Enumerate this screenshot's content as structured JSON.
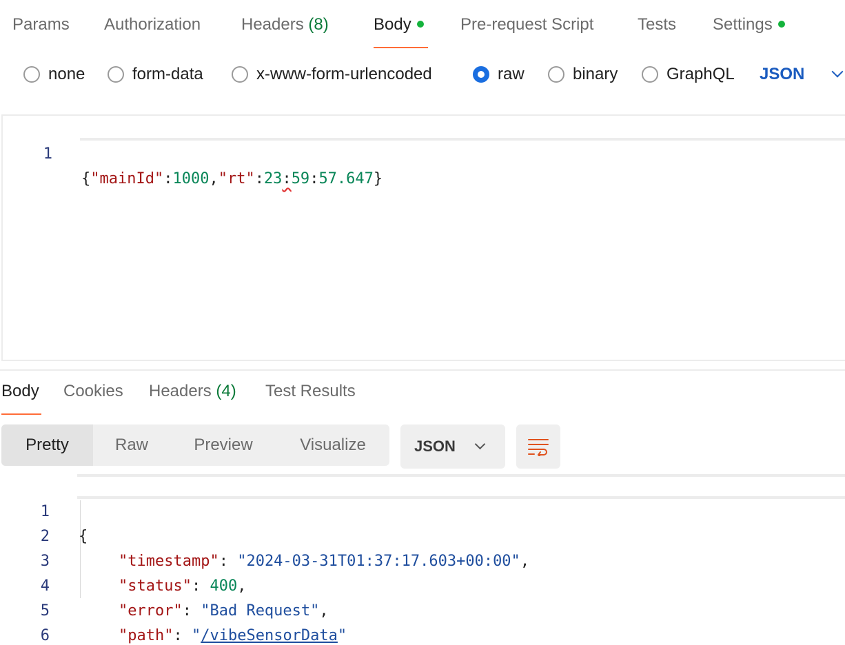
{
  "request_tabs": [
    {
      "label": "Params"
    },
    {
      "label": "Authorization"
    },
    {
      "label": "Headers",
      "count": "(8)"
    },
    {
      "label": "Body",
      "indicator": true,
      "active": true
    },
    {
      "label": "Pre-request Script"
    },
    {
      "label": "Tests"
    },
    {
      "label": "Settings",
      "indicator": true
    }
  ],
  "body_types": [
    {
      "label": "none",
      "checked": false
    },
    {
      "label": "form-data",
      "checked": false
    },
    {
      "label": "x-www-form-urlencoded",
      "checked": false
    },
    {
      "label": "raw",
      "checked": true
    },
    {
      "label": "binary",
      "checked": false
    },
    {
      "label": "GraphQL",
      "checked": false
    }
  ],
  "raw_format": "JSON",
  "request_body": {
    "line_number": "1",
    "tokens": {
      "open": "{",
      "key1": "\"mainId\"",
      "colon1": ":",
      "val1": "1000",
      "comma": ",",
      "key2": "\"rt\"",
      "colon2": ":",
      "val2a": "23",
      "colon3": ":",
      "val2b": "59",
      "colon4": ":",
      "val2c": "57.647",
      "close": "}"
    }
  },
  "response_tabs": [
    {
      "label": "Body",
      "active": true
    },
    {
      "label": "Cookies"
    },
    {
      "label": "Headers",
      "count": "(4)"
    },
    {
      "label": "Test Results"
    }
  ],
  "view_modes": [
    "Pretty",
    "Raw",
    "Preview",
    "Visualize"
  ],
  "response_format": "JSON",
  "response_body": {
    "line_numbers": [
      "1",
      "2",
      "3",
      "4",
      "5",
      "6"
    ],
    "open": "{",
    "close": "}",
    "fields": [
      {
        "key": "\"timestamp\"",
        "value": "\"2024-03-31T01:37:17.603+00:00\"",
        "trail": ","
      },
      {
        "key": "\"status\"",
        "value": "400",
        "trail": ","
      },
      {
        "key": "\"error\"",
        "value": "\"Bad Request\"",
        "trail": ","
      },
      {
        "key": "\"path\"",
        "value_quote": "\"",
        "value": "/vibeSensorData",
        "trail": ""
      }
    ]
  },
  "colors": {
    "accent": "#ff6c37",
    "radio_checked": "#1a6ee0",
    "indicator": "#14b33c",
    "json_key": "#a31515",
    "json_number": "#098658",
    "json_string": "#1f4e9e"
  },
  "icons": {
    "wrap": "text-wrap-icon",
    "dropdown": "chevron-down-icon"
  }
}
